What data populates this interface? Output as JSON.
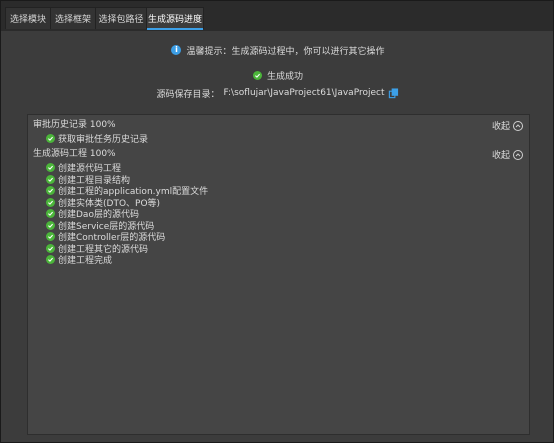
{
  "tabs": [
    {
      "label": "选择模块"
    },
    {
      "label": "选择框架"
    },
    {
      "label": "选择包路径"
    },
    {
      "label": "生成源码进度",
      "active": true
    }
  ],
  "tip": {
    "icon": "info-icon",
    "text": "温馨提示：生成源码过程中，你可以进行其它操作"
  },
  "status": {
    "icon": "check-circle-icon",
    "text": "生成成功"
  },
  "save_path": {
    "label": "源码保存目录：",
    "value": "F:\\soflujar\\JavaProject61\\JavaProject",
    "copy_icon": "copy-icon"
  },
  "sections": [
    {
      "title": "审批历史记录 100%",
      "collapse_label": "收起",
      "items": [
        "获取审批任务历史记录"
      ]
    },
    {
      "title": "生成源码工程 100%",
      "collapse_label": "收起",
      "items": [
        "创建源代码工程",
        "创建工程目录结构",
        "创建工程的application.yml配置文件",
        "创建实体类(DTO、PO等)",
        "创建Dao层的源代码",
        "创建Service层的源代码",
        "创建Controller层的源代码",
        "创建工程其它的源代码",
        "创建工程完成"
      ]
    }
  ],
  "colors": {
    "accent": "#3ca0e8",
    "success": "#4bb53a",
    "panel": "#454545",
    "window": "#3c3c3c"
  }
}
